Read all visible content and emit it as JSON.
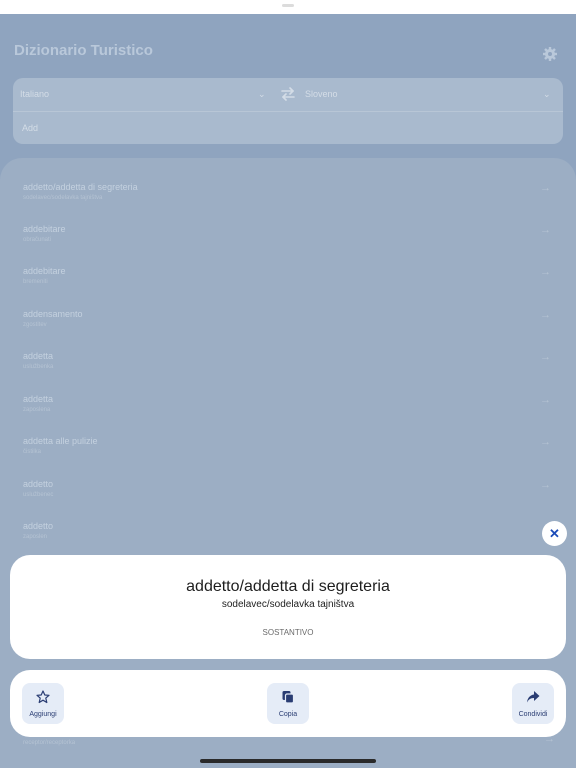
{
  "app": {
    "title": "Dizionario Turistico",
    "settings_icon": "gear-icon"
  },
  "languages": {
    "source": "Italiano",
    "target": "Sloveno",
    "swap_icon": "swap-arrows-icon",
    "chevron": "⌄"
  },
  "search": {
    "placeholder": "Add",
    "value": ""
  },
  "list": {
    "arrow": "→",
    "items": [
      {
        "term": "addetto/addetta di segreteria",
        "translation": "sodelavec/sodelavka tajništva"
      },
      {
        "term": "addebitare",
        "translation": "obračunati"
      },
      {
        "term": "addebitare",
        "translation": "bremeniti"
      },
      {
        "term": "addensamento",
        "translation": "zgostitev"
      },
      {
        "term": "addetta",
        "translation": "uslužbenka"
      },
      {
        "term": "addetta",
        "translation": "zaposlena"
      },
      {
        "term": "addetta alle pulizie",
        "translation": "čistilka"
      },
      {
        "term": "addetto",
        "translation": "uslužbenec"
      },
      {
        "term": "addetto",
        "translation": "zaposlen"
      }
    ],
    "partially_hidden_item": {
      "translation": "receptor/receptorka"
    }
  },
  "detail": {
    "word": "addetto/addetta di segreteria",
    "translation": "sodelavec/sodelavka tajništva",
    "part_of_speech": "SOSTANTIVO",
    "close_symbol": "✕"
  },
  "actions": [
    {
      "label": "Aggiungi",
      "icon": "star-icon"
    },
    {
      "label": "Copia",
      "icon": "copy-icon"
    },
    {
      "label": "Condividi",
      "icon": "share-icon"
    }
  ],
  "colors": {
    "accent": "#1b4bb8",
    "overlay": "#8fa4bf",
    "card": "#ffffff",
    "button_bg": "#e5ecf7"
  }
}
